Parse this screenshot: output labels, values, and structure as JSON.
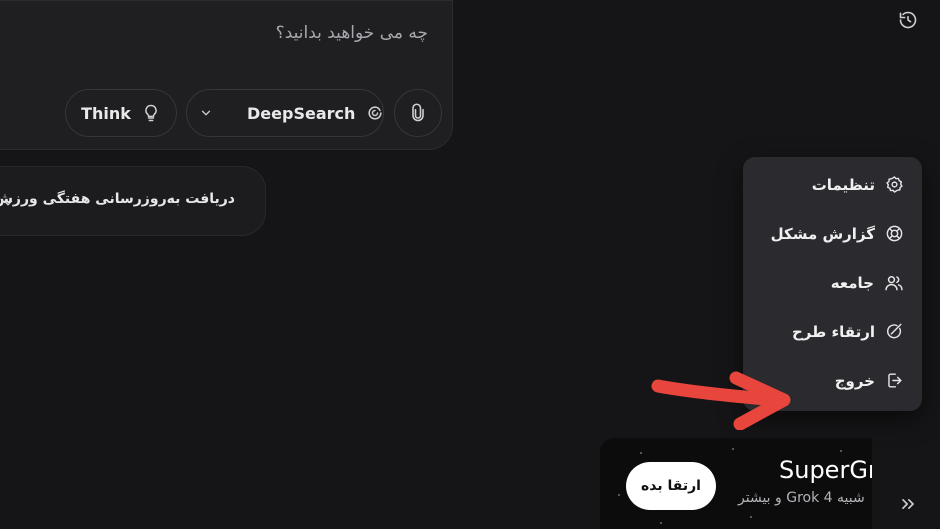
{
  "prompt": {
    "placeholder": "چه می خواهید بدانید؟",
    "think_label": "Think",
    "deepsearch_label": "DeepSearch"
  },
  "suggestion": {
    "label": "دریافت به‌روزرسانی هفتگی ورزش"
  },
  "menu": {
    "items": [
      {
        "label": "تنظیمات",
        "icon": "gear-icon"
      },
      {
        "label": "گزارش مشکل",
        "icon": "help-ring-icon"
      },
      {
        "label": "جامعه",
        "icon": "users-icon"
      },
      {
        "label": "ارتقاء طرح",
        "icon": "upgrade-plan-icon"
      },
      {
        "label": "خروج",
        "icon": "logout-icon"
      }
    ]
  },
  "promo": {
    "title": "SuperGrok",
    "subtitle": "شبیه Grok 4 و بیشتر",
    "button_label": "ارتقا بده"
  },
  "colors": {
    "background": "#151416",
    "menu_bg": "#2b2a2e",
    "annotation_arrow": "#e8453c"
  }
}
